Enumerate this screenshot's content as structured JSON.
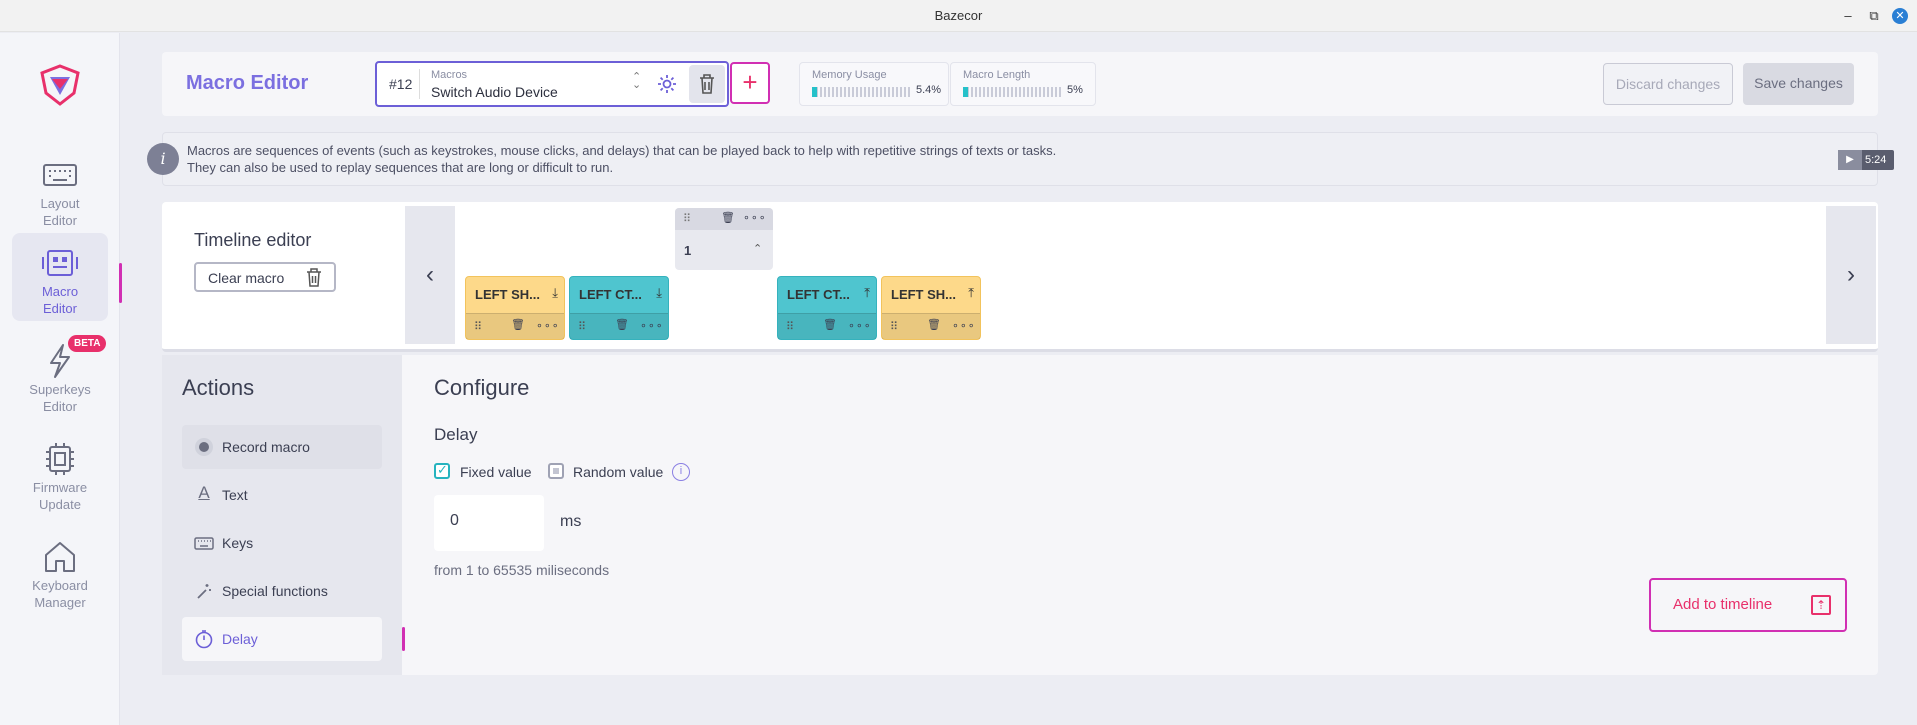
{
  "window": {
    "title": "Bazecor",
    "minimize": "–",
    "maximize": "⧉",
    "close": "✕"
  },
  "sidebar": {
    "items": [
      {
        "label": "Layout\nEditor",
        "icon": "keyboard-icon"
      },
      {
        "label": "Macro\nEditor",
        "icon": "macro-icon"
      },
      {
        "label": "Superkeys\nEditor",
        "icon": "lightning-icon"
      },
      {
        "label": "Firmware\nUpdate",
        "icon": "chip-icon"
      },
      {
        "label": "Keyboard\nManager",
        "icon": "home-icon"
      }
    ],
    "beta_badge": "BETA",
    "active_index": 1
  },
  "header": {
    "title": "Macro Editor",
    "macro_number": "#12",
    "macro_select_label": "Macros",
    "macro_select_value": "Switch Audio Device",
    "add_label": "+",
    "memory_label": "Memory Usage",
    "memory_value": "5.4%",
    "memory_fraction": 0.054,
    "length_label": "Macro Length",
    "length_value": "5%",
    "length_fraction": 0.05,
    "discard_label": "Discard changes",
    "save_label": "Save changes"
  },
  "info": {
    "icon_glyph": "i",
    "line1": "Macros are sequences of events (such as keystrokes, mouse clicks, and delays) that can be played back to help with repetitive strings of texts or tasks.",
    "line2": "They can also be used to replay sequences that are long or difficult to run.",
    "video_time": "5:24"
  },
  "timeline": {
    "title": "Timeline editor",
    "clear_label": "Clear macro",
    "prev": "‹",
    "next": "›",
    "delay_value": "1",
    "cards": [
      {
        "label": "LEFT SH...",
        "color": "yellow",
        "direction": "down"
      },
      {
        "label": "LEFT CT...",
        "color": "teal",
        "direction": "down"
      },
      {
        "label": "LEFT CT...",
        "color": "teal",
        "direction": "up"
      },
      {
        "label": "LEFT SH...",
        "color": "yellow",
        "direction": "up"
      }
    ]
  },
  "actions": {
    "title": "Actions",
    "items": [
      {
        "label": "Record macro",
        "icon": "record-icon"
      },
      {
        "label": "Text",
        "icon": "text-icon"
      },
      {
        "label": "Keys",
        "icon": "keyboard-icon"
      },
      {
        "label": "Special functions",
        "icon": "magic-wand-icon"
      },
      {
        "label": "Delay",
        "icon": "stopwatch-icon"
      }
    ]
  },
  "configure": {
    "title": "Configure",
    "section": "Delay",
    "fixed_label": "Fixed value",
    "random_label": "Random value",
    "fixed_checked": true,
    "random_checked": false,
    "value": "0",
    "unit": "ms",
    "range_text": "from 1 to 65535 miliseconds",
    "add_label": "Add to timeline"
  }
}
